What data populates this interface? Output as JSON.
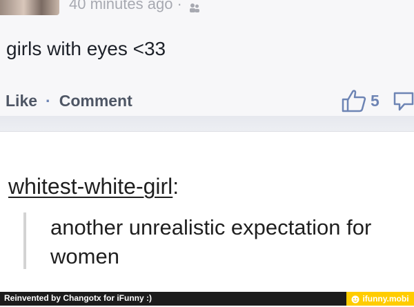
{
  "post": {
    "timestamp": "40 minutes ago",
    "separator": "·",
    "text": "girls with eyes <33",
    "actions": {
      "like_label": "Like",
      "dot": "·",
      "comment_label": "Comment"
    },
    "like_count": "5",
    "colors": {
      "accent": "#6d84b4",
      "action_text": "#4e5665"
    },
    "icons": {
      "privacy": "friends-icon",
      "like": "thumbs-up-icon",
      "comment": "speech-bubble-icon"
    }
  },
  "reply": {
    "username": "whitest-white-girl",
    "colon": ":",
    "quote": "another unrealistic expectation for women"
  },
  "footer": {
    "left_text": "Reinvented by Changotx for iFunny :)",
    "right_text": "ifunny.mobi",
    "brand_color": "#ffcc00"
  }
}
